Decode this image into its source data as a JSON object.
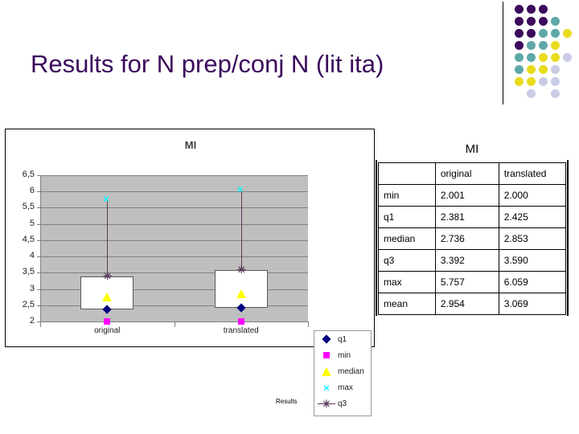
{
  "slide": {
    "title": "Results for N prep/conj N (lit ita)",
    "footer": "Results",
    "title_color": "#3B0A5C"
  },
  "decoration": {
    "name": "dot-grid",
    "colors": {
      "purple": "#3B0A5C",
      "teal": "#5FA8A8",
      "yellow": "#E8DC1E",
      "lavender": "#C9CCE5"
    },
    "dots": [
      {
        "col": 0,
        "row": 0,
        "color": "#3B0A5C"
      },
      {
        "col": 1,
        "row": 0,
        "color": "#3B0A5C"
      },
      {
        "col": 2,
        "row": 0,
        "color": "#3B0A5C"
      },
      {
        "col": 0,
        "row": 1,
        "color": "#3B0A5C"
      },
      {
        "col": 1,
        "row": 1,
        "color": "#3B0A5C"
      },
      {
        "col": 2,
        "row": 1,
        "color": "#3B0A5C"
      },
      {
        "col": 3,
        "row": 1,
        "color": "#5FA8A8"
      },
      {
        "col": 0,
        "row": 2,
        "color": "#3B0A5C"
      },
      {
        "col": 1,
        "row": 2,
        "color": "#3B0A5C"
      },
      {
        "col": 2,
        "row": 2,
        "color": "#5FA8A8"
      },
      {
        "col": 3,
        "row": 2,
        "color": "#5FA8A8"
      },
      {
        "col": 4,
        "row": 2,
        "color": "#E8DC1E"
      },
      {
        "col": 0,
        "row": 3,
        "color": "#3B0A5C"
      },
      {
        "col": 1,
        "row": 3,
        "color": "#5FA8A8"
      },
      {
        "col": 2,
        "row": 3,
        "color": "#5FA8A8"
      },
      {
        "col": 3,
        "row": 3,
        "color": "#E8DC1E"
      },
      {
        "col": 0,
        "row": 4,
        "color": "#5FA8A8"
      },
      {
        "col": 1,
        "row": 4,
        "color": "#5FA8A8"
      },
      {
        "col": 2,
        "row": 4,
        "color": "#E8DC1E"
      },
      {
        "col": 3,
        "row": 4,
        "color": "#E8DC1E"
      },
      {
        "col": 4,
        "row": 4,
        "color": "#C9CCE5"
      },
      {
        "col": 0,
        "row": 5,
        "color": "#5FA8A8"
      },
      {
        "col": 1,
        "row": 5,
        "color": "#E8DC1E"
      },
      {
        "col": 2,
        "row": 5,
        "color": "#E8DC1E"
      },
      {
        "col": 3,
        "row": 5,
        "color": "#C9CCE5"
      },
      {
        "col": 0,
        "row": 6,
        "color": "#E8DC1E"
      },
      {
        "col": 1,
        "row": 6,
        "color": "#E8DC1E"
      },
      {
        "col": 2,
        "row": 6,
        "color": "#C9CCE5"
      },
      {
        "col": 3,
        "row": 6,
        "color": "#C9CCE5"
      },
      {
        "col": 1,
        "row": 7,
        "color": "#C9CCE5"
      },
      {
        "col": 3,
        "row": 7,
        "color": "#C9CCE5"
      }
    ]
  },
  "chart_data": {
    "type": "scatter",
    "title": "MI",
    "xlabel": "",
    "ylabel": "",
    "categories": [
      "original",
      "translated"
    ],
    "ylim": [
      2,
      6.5
    ],
    "yticks": [
      2,
      2.5,
      3,
      3.5,
      4,
      4.5,
      5,
      5.5,
      6,
      6.5
    ],
    "ytick_labels": [
      "2",
      "2,5",
      "3",
      "3,5",
      "4",
      "4,5",
      "5",
      "5,5",
      "6",
      "6,5"
    ],
    "grid": true,
    "legend_position": "right",
    "plot_background": "#BFBFBF",
    "series": [
      {
        "name": "q1",
        "marker": "diamond",
        "color": "#000080",
        "values": [
          2.381,
          2.425
        ]
      },
      {
        "name": "min",
        "marker": "square",
        "color": "#FF00FF",
        "values": [
          2.001,
          2.0
        ]
      },
      {
        "name": "median",
        "marker": "triangle",
        "color": "#FFFF00",
        "values": [
          2.736,
          2.853
        ]
      },
      {
        "name": "max",
        "marker": "x",
        "color": "#00FFFF",
        "values": [
          5.757,
          6.059
        ]
      },
      {
        "name": "q3",
        "marker": "star",
        "color": "#5B3A5B",
        "values": [
          3.392,
          3.59
        ]
      }
    ]
  },
  "table": {
    "title": "MI",
    "columns": [
      "",
      "original",
      "translated"
    ],
    "rows": [
      {
        "label": "min",
        "original": "2.001",
        "translated": "2.000"
      },
      {
        "label": "q1",
        "original": "2.381",
        "translated": "2.425"
      },
      {
        "label": "median",
        "original": "2.736",
        "translated": "2.853"
      },
      {
        "label": "q3",
        "original": "3.392",
        "translated": "3.590"
      },
      {
        "label": "max",
        "original": "5.757",
        "translated": "6.059"
      },
      {
        "label": "mean",
        "original": "2.954",
        "translated": "3.069"
      }
    ]
  }
}
